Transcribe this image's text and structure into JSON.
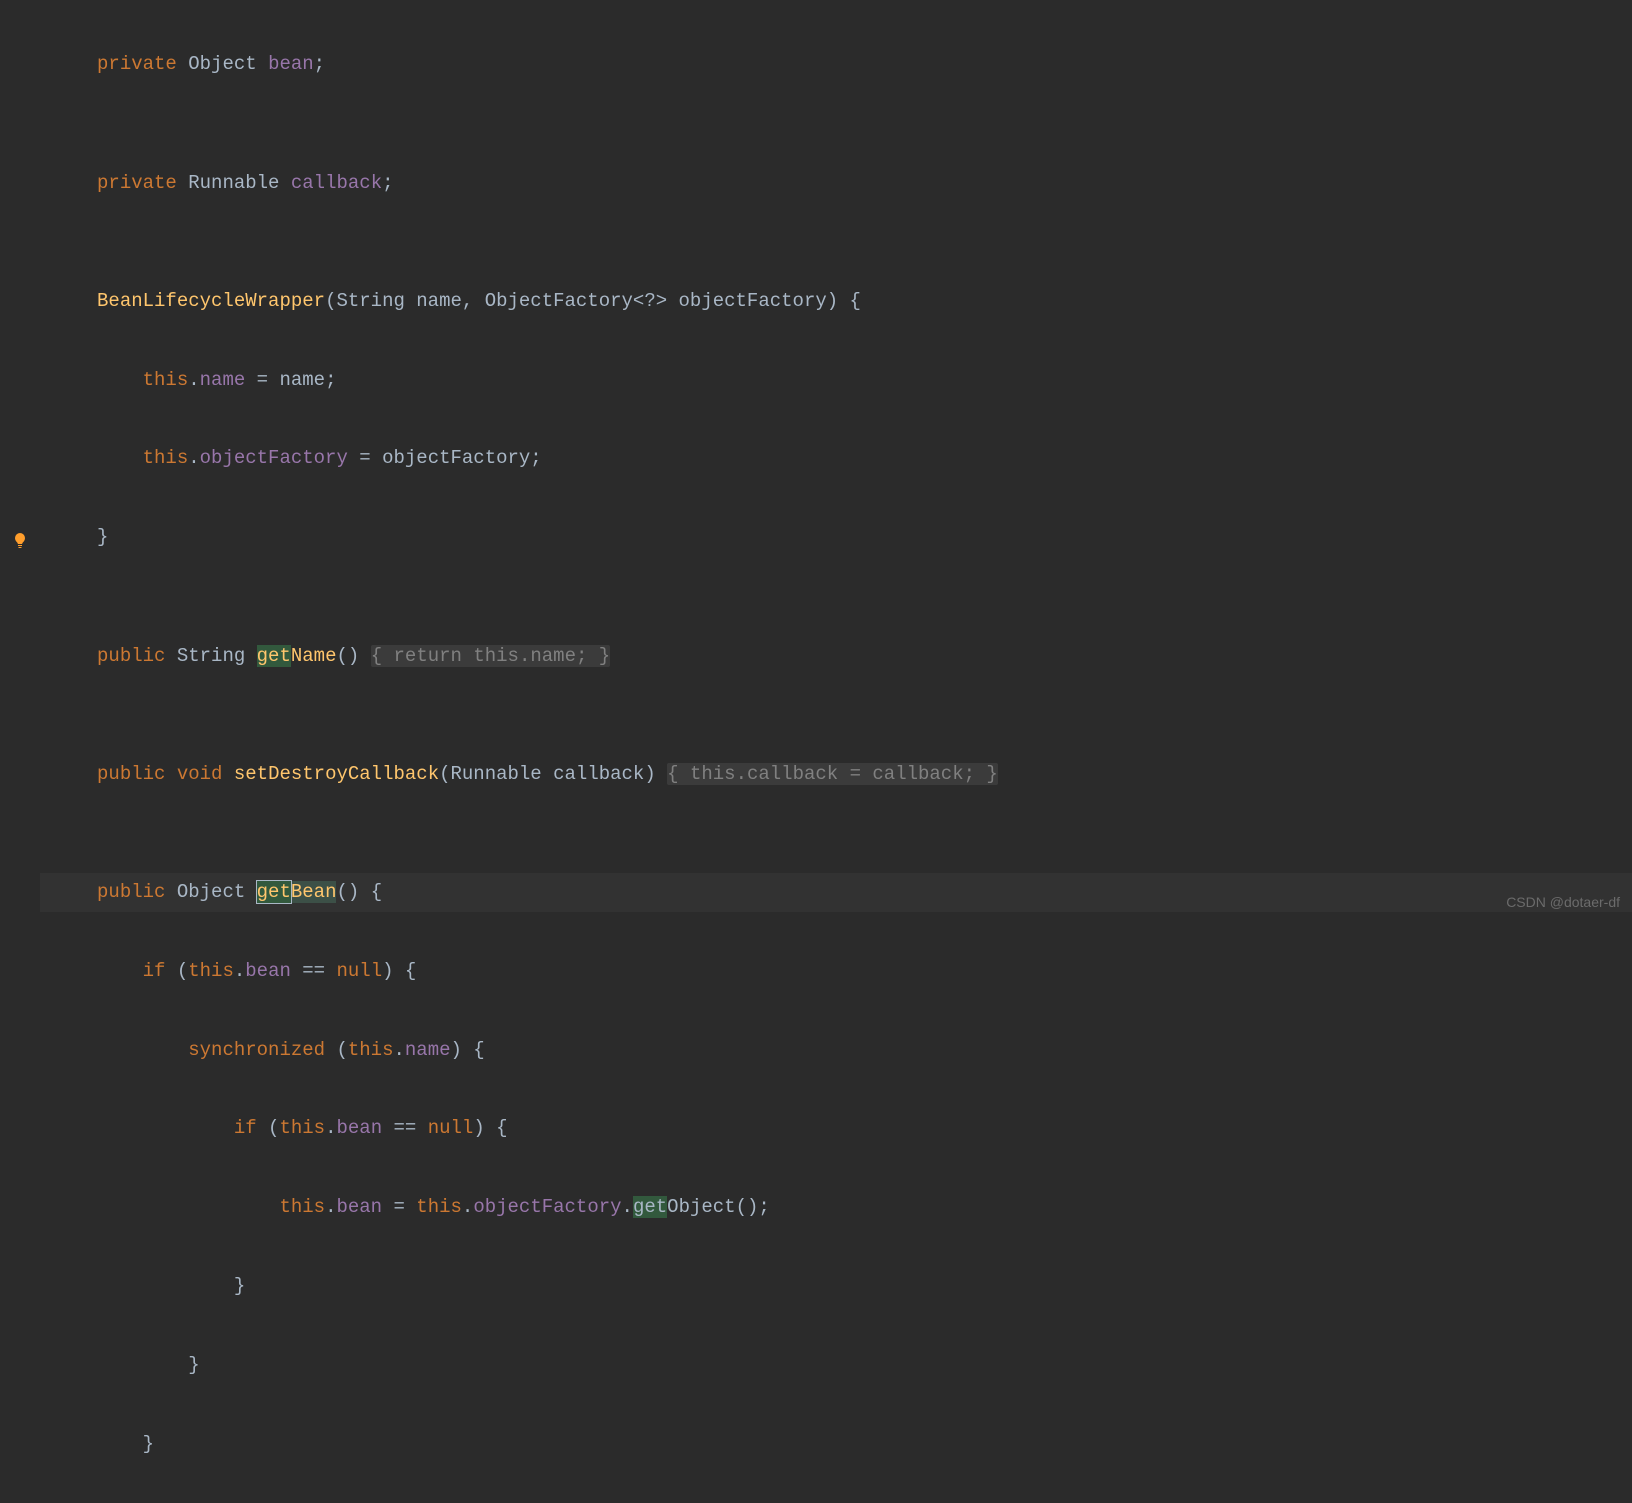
{
  "code": {
    "l1": {
      "kw": "private",
      "type": " Object ",
      "field": "bean",
      "end": ";"
    },
    "l2": {
      "kw": "private",
      "type": " Runnable ",
      "field": "callback",
      "end": ";"
    },
    "l3": {
      "ctor": "BeanLifecycleWrapper",
      "sig": "(String name, ObjectFactory<?> objectFactory) {"
    },
    "l4": {
      "kw": "this",
      "dot": ".",
      "field": "name",
      "rest": " = name;"
    },
    "l5": {
      "kw": "this",
      "dot": ".",
      "field": "objectFactory",
      "rest": " = objectFactory;"
    },
    "l6": {
      "close": "}"
    },
    "l7": {
      "kw": "public",
      "type": " String ",
      "hl": "get",
      "fn": "Name",
      "sig": "() ",
      "fold": "{ return this.name; }"
    },
    "l8": {
      "kw": "public",
      "ret": " void ",
      "fn": "setDestroyCallback",
      "sig": "(Runnable callback) ",
      "fold": "{ this.callback = callback; }"
    },
    "l9": {
      "kw": "public",
      "type": " Object ",
      "sel": "get",
      "fn": "Bean",
      "sig": "() {"
    },
    "l10": {
      "kw": "if",
      "open": " (",
      "kw2": "this",
      "dot": ".",
      "field": "bean",
      "rest": " == ",
      "kw3": "null",
      "end": ") {"
    },
    "l11": {
      "kw": "synchronized",
      "open": " (",
      "kw2": "this",
      "dot": ".",
      "field": "name",
      "end": ") {"
    },
    "l12": {
      "kw": "if",
      "open": " (",
      "kw2": "this",
      "dot": ".",
      "field": "bean",
      "rest": " == ",
      "kw3": "null",
      "end": ") {"
    },
    "l13": {
      "kw": "this",
      "dot": ".",
      "field": "bean",
      "eq": " = ",
      "kw2": "this",
      "dot2": ".",
      "field2": "objectFactory",
      "dot3": ".",
      "hl": "get",
      "fn": "Object",
      "end": "();"
    },
    "l14": {
      "close": "}"
    },
    "l15": {
      "close": "}"
    },
    "l16": {
      "close": "}"
    }
  },
  "fold": {
    "getName_open": "{",
    "getName_body": " return this.name; ",
    "getName_close": "}",
    "setDestroy_open": "{",
    "setDestroy_body": " this.callback = callback; ",
    "setDestroy_close": "}"
  },
  "watermark": "CSDN @dotaer-df"
}
